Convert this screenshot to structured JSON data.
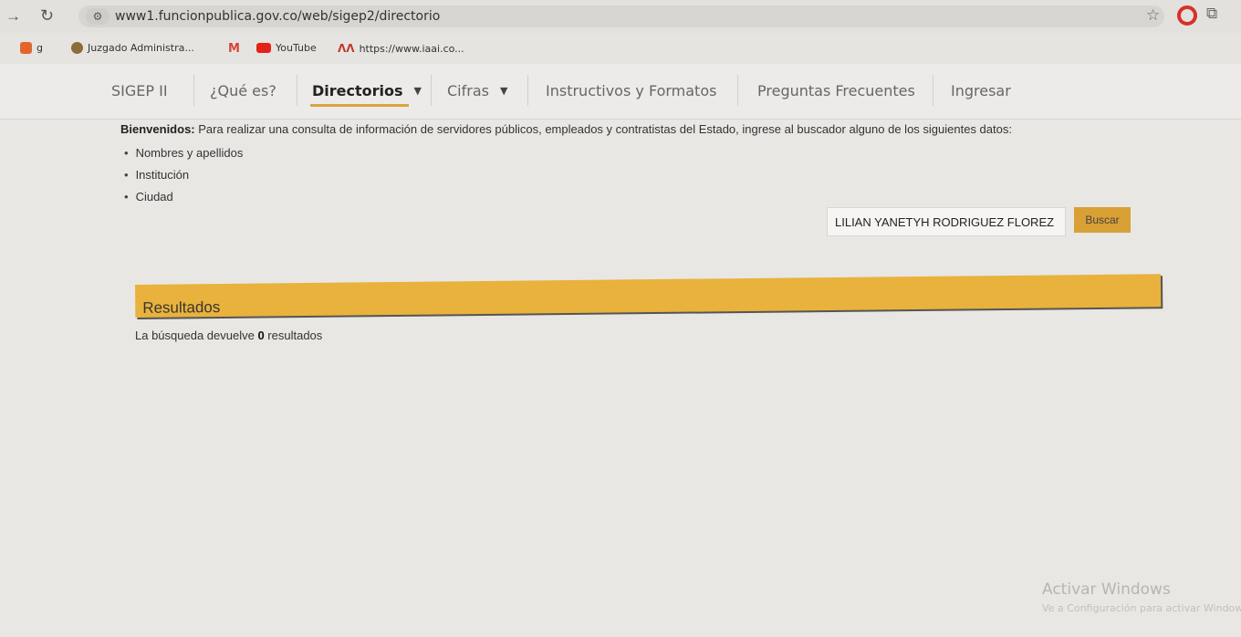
{
  "browser": {
    "url": "www1.funcionpublica.gov.co/web/sigep2/directorio",
    "bookmarks": [
      {
        "label": "g",
        "icon": "orange-extension-icon",
        "color": "#e2662c"
      },
      {
        "label": "Juzgado Administra...",
        "icon": "seal-icon",
        "color": "#8a6d3b"
      },
      {
        "label": "",
        "icon": "gmail-icon",
        "color": "#d44638"
      },
      {
        "label": "YouTube",
        "icon": "youtube-icon",
        "color": "#e62117"
      },
      {
        "label": "https://www.iaai.co...",
        "icon": "iaai-icon",
        "color": "#c0392b"
      }
    ]
  },
  "nav": {
    "items": [
      "SIGEP II",
      "¿Qué es?",
      "Directorios",
      "Cifras",
      "Instructivos y Formatos",
      "Preguntas Frecuentes",
      "Ingresar"
    ],
    "active_color": "#d9a441"
  },
  "intro": {
    "bold": "Bienvenidos:",
    "text": " Para realizar una consulta de información de servidores públicos, empleados y contratistas del Estado, ingrese al buscador alguno de los siguientes datos:",
    "criteria": [
      "Nombres y apellidos",
      "Institución",
      "Ciudad"
    ]
  },
  "search": {
    "value": "LILIAN YANETYH RODRIGUEZ FLOREZ",
    "button": "Buscar",
    "button_color": "#d9a035"
  },
  "results": {
    "title": "Resultados",
    "prefix": "La búsqueda devuelve ",
    "count": "0",
    "suffix": " resultados",
    "bar_color": "#e8b23c"
  },
  "watermark": {
    "title": "Activar Windows",
    "subtitle": "Ve a Configuración para activar Windows."
  }
}
